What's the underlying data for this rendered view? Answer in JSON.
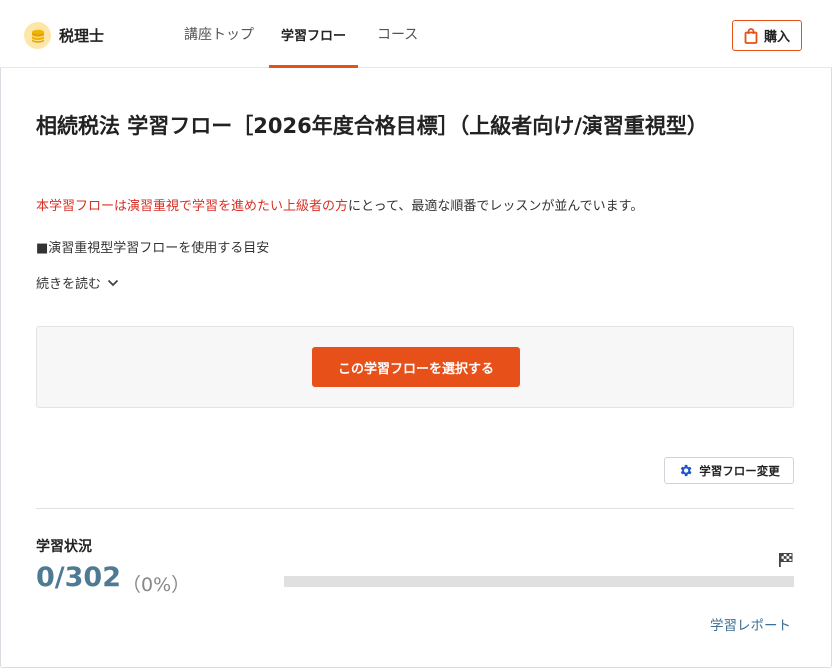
{
  "header": {
    "brand": "税理士",
    "nav": {
      "top": "講座トップ",
      "flow": "学習フロー",
      "course": "コース"
    },
    "buy_label": "購入"
  },
  "main": {
    "title": "相続税法 学習フロー［2026年度合格目標］（上級者向け/演習重視型）",
    "intro_highlight": "本学習フローは演習重視で学習を進めたい上級者の方",
    "intro_rest": "にとって、最適な順番でレッスンが並んでいます。",
    "bullet": "■演習重視型学習フローを使用する目安",
    "read_more": "続きを読む",
    "select_label": "この学習フローを選択する",
    "change_label": "学習フロー変更"
  },
  "status": {
    "label": "学習状況",
    "count": "0/302",
    "percent": "（0%）",
    "progress_fraction": 0,
    "report_link": "学習レポート"
  },
  "colors": {
    "accent": "#e8501a",
    "status": "#4f7a93",
    "link": "#3d6f95",
    "highlight_red": "#d93025",
    "gear_icon": "#1a56c9"
  },
  "icons": {
    "logo": "coin-stack-icon",
    "buy": "shopping-bag-icon",
    "read_more": "chevron-down-icon",
    "change": "gear-icon",
    "goal": "checkered-flag-icon"
  }
}
